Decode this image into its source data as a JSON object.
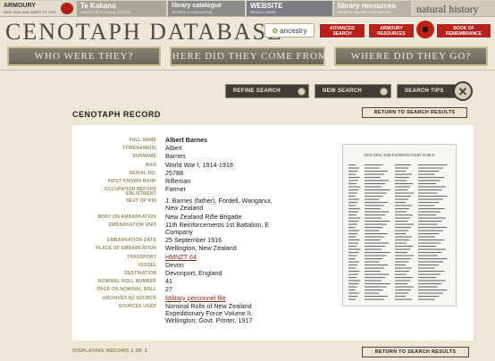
{
  "top_strip": {
    "armoury": {
      "main": "ARMOURY",
      "sub": "NEW ZEALAND WARS TO 1945"
    },
    "tekakano": {
      "main": "Te Kakano",
      "sub": "PACIFIC RESOURCE CENTRE"
    },
    "library_catalogue": {
      "main": "library catalogue",
      "sub": "SEARCH & CATALOGUE"
    },
    "website": {
      "main": "WEBSITE",
      "sub": "SEARCH HERE"
    },
    "library_resources": {
      "main": "library resources",
      "sub": "SEARCH ONLINE RESOURCES"
    },
    "natural_history": {
      "main": "natural history"
    }
  },
  "header": {
    "title": "CENOTAPH DATABASE",
    "ancestry_label": "ancestry",
    "advanced_search": "ADVANCED SEARCH",
    "armoury_resources": "ARMOURY RESOURCES",
    "book_of_remembrance": "BOOK OF REMEMBRANCE"
  },
  "nav": {
    "tabs": [
      {
        "label": "WHO WERE THEY?"
      },
      {
        "label": "WHERE DID THEY COME FROM?"
      },
      {
        "label": "WHERE DID THEY GO?"
      }
    ]
  },
  "actions": {
    "refine_search": "REFINE SEARCH",
    "new_search": "NEW SEARCH",
    "search_tips": "SEARCH TIPS",
    "close_symbol": "✕"
  },
  "record": {
    "title": "CENOTAPH RECORD",
    "return_label": "RETURN TO SEARCH RESULTS",
    "fields": [
      {
        "label": "FULL NAME",
        "value": "Albert Barnes"
      },
      {
        "label": "FORENAME(S)",
        "value": "Albert"
      },
      {
        "label": "SURNAME",
        "value": "Barnes"
      },
      {
        "label": "WAR",
        "value": "World War I, 1914-1918"
      },
      {
        "label": "SERIAL NO.",
        "value": "25788"
      },
      {
        "label": "FIRST KNOWN RANK",
        "value": "Rifleman"
      },
      {
        "label": "OCCUPATION BEFORE ENLISTMENT",
        "value": "Farmer"
      },
      {
        "label": "NEXT OF KIN",
        "value": "J. Barnes (father), Fordell, Wanganui, New Zealand"
      },
      {
        "label": "BODY ON EMBARKATION",
        "value": "New Zealand Rifle Brigade"
      },
      {
        "label": "EMBARKATION UNIT",
        "value": "11th Reinforcements 1st Battalion, E Company"
      },
      {
        "label": "EMBARKATION DATE",
        "value": "25 September 1916"
      },
      {
        "label": "PLACE OF EMBARKATION",
        "value": "Wellington, New Zealand"
      },
      {
        "label": "TRANSPORT",
        "value": "HMNZT 64"
      },
      {
        "label": "VESSEL",
        "value": "Devon"
      },
      {
        "label": "DESTINATION",
        "value": "Devonport, England"
      },
      {
        "label": "NOMINAL ROLL NUMBER",
        "value": "41"
      },
      {
        "label": "PAGE ON NOMINAL ROLL",
        "value": "27"
      },
      {
        "label": "ARCHIVES NZ SOURCE",
        "value": "Military personnel file"
      },
      {
        "label": "SOURCES USED",
        "value": "Nominal Rolls of New Zealand Expeditionary Force Volume II. Wellington: Govt. Printer, 1917"
      }
    ],
    "document_heading": "NEW ZEALAND EXPEDITIONARY FORCE"
  },
  "pager": {
    "text": "DISPLAYING RECORD 1 OF 1"
  },
  "colors": {
    "background": "#ece7d6",
    "accent_red": "#b8201a",
    "nav_tab": "#75735f",
    "label_gold": "#9a8a5a",
    "link": "#8a2a1e"
  }
}
